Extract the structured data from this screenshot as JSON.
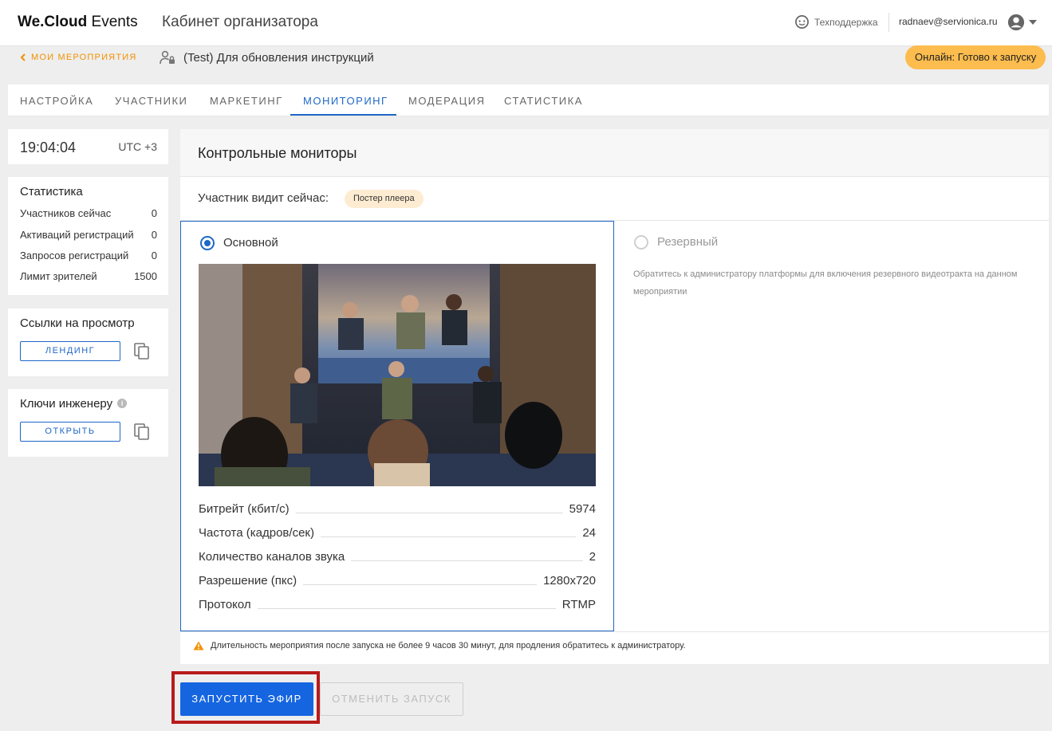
{
  "header": {
    "brand_bold": "We.Cloud",
    "brand_light": "Events",
    "cabinet_title": "Кабинет организатора",
    "support_label": "Техподдержка",
    "user_email": "radnaev@servionica.ru"
  },
  "breadcrumb": {
    "back_label": "МОИ МЕРОПРИЯТИЯ",
    "event_title": "(Test) Для обновления инструкций"
  },
  "status": {
    "label": "Онлайн: Готово к запуску",
    "color": "#fcbc4e"
  },
  "tabs": [
    {
      "label": "НАСТРОЙКА"
    },
    {
      "label": "УЧАСТНИКИ"
    },
    {
      "label": "МАРКЕТИНГ"
    },
    {
      "label": "МОНИТОРИНГ",
      "active": true
    },
    {
      "label": "МОДЕРАЦИЯ"
    },
    {
      "label": "СТАТИСТИКА"
    }
  ],
  "clock": {
    "time": "19:04:04",
    "timezone": "UTC +3"
  },
  "statistics": {
    "title": "Статистика",
    "rows": [
      {
        "label": "Участников сейчас",
        "value": "0"
      },
      {
        "label": "Активаций регистраций",
        "value": "0"
      },
      {
        "label": "Запросов регистраций",
        "value": "0"
      },
      {
        "label": "Лимит зрителей",
        "value": "1500"
      }
    ]
  },
  "view_links": {
    "title": "Ссылки на просмотр",
    "button": "ЛЕНДИНГ"
  },
  "engineer_keys": {
    "title": "Ключи инженеру",
    "button": "ОТКРЫТЬ"
  },
  "monitors": {
    "title": "Контрольные мониторы",
    "sees_now_label": "Участник видит сейчас:",
    "sees_now_value": "Постер плеера",
    "primary": {
      "label": "Основной",
      "selected": true,
      "metrics": [
        {
          "label": "Битрейт (кбит/с)",
          "value": "5974"
        },
        {
          "label": "Частота (кадров/сек)",
          "value": "24"
        },
        {
          "label": "Количество каналов звука",
          "value": "2"
        },
        {
          "label": "Разрешение (пкс)",
          "value": "1280x720"
        },
        {
          "label": "Протокол",
          "value": "RTMP"
        }
      ]
    },
    "backup": {
      "label": "Резервный",
      "selected": false,
      "note": "Обратитесь к администратору платформы для включения резервного видеотракта на данном мероприятии"
    },
    "warning": "Длительность мероприятия после запуска не более 9 часов 30 минут, для продления обратитесь к администратору."
  },
  "actions": {
    "start_label": "ЗАПУСТИТЬ ЭФИР",
    "cancel_label": "ОТМЕНИТЬ ЗАПУСК"
  },
  "colors": {
    "accent": "#1f67c6",
    "primary_button": "#1565e0",
    "orange": "#f29100",
    "highlight": "#b81b1b"
  }
}
